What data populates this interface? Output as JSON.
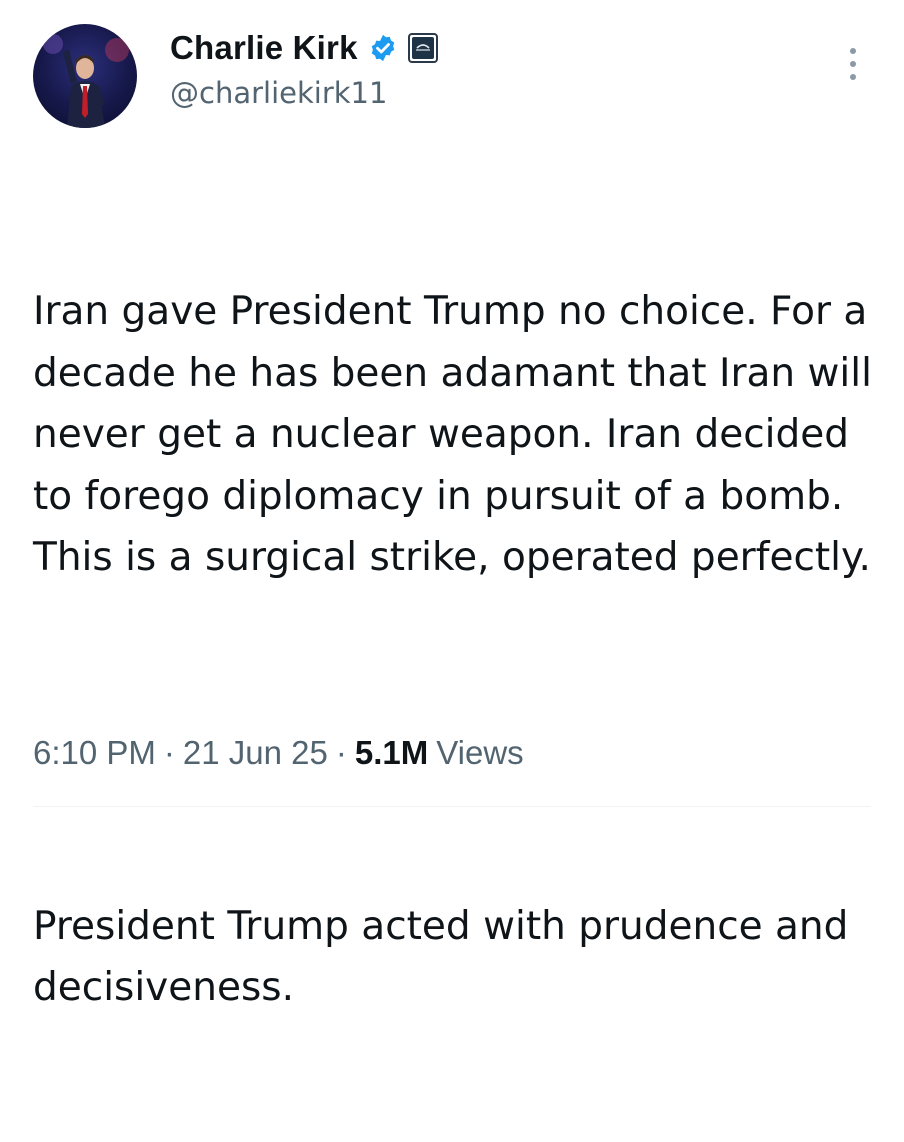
{
  "tweet": {
    "author": {
      "display_name": "Charlie Kirk",
      "handle": "@charliekirk11",
      "verified_badge_icon": "verified-badge-icon",
      "affiliate_badge_icon": "affiliate-badge-icon",
      "verified_color": "#1d9bf0"
    },
    "body": {
      "paragraph_1": "Iran gave President Trump no choice. For a decade he has been adamant that Iran will never get a nuclear weapon. Iran decided to forego diplomacy in pursuit of a bomb. This is a surgical strike, operated perfectly.",
      "paragraph_2": "President Trump acted with prudence and decisiveness."
    },
    "meta": {
      "time": "6:10 PM",
      "separator": "·",
      "date": "21 Jun 25",
      "views_count": "5.1M",
      "views_label": "Views"
    },
    "more_icon": "more-vertical-icon"
  }
}
